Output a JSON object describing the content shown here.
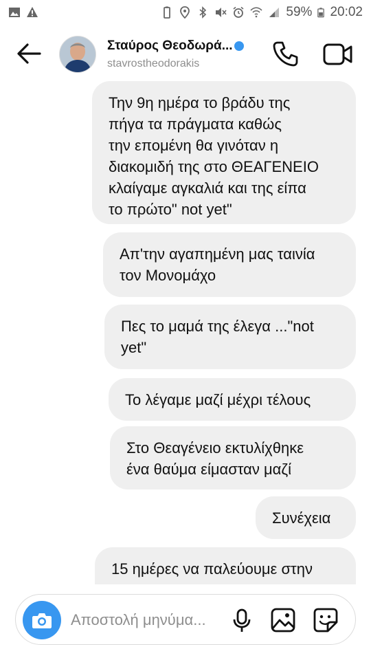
{
  "status_bar": {
    "battery": "59%",
    "time": "20:02"
  },
  "header": {
    "name": "Σταύρος Θεοδωρά...",
    "username": "stavrostheodorakis"
  },
  "messages": [
    {
      "text": "Την 9η ημέρα το βράδυ της\nπήγα τα πράγματα καθώς\nτην επομένη θα γινόταν η\nδιακομιδή της στο ΘΕΑΓΕΝΕΙΟ\nκλαίγαμε αγκαλιά και της είπα\nτο πρώτο\" not yet\""
    },
    {
      "text": "Απ'την αγαπημένη μας ταινία\nτον Μονομάχο"
    },
    {
      "text": "Πες το μαμά της έλεγα ...\"not\nyet\""
    },
    {
      "text": "Το λέγαμε μαζί μέχρι τέλους"
    },
    {
      "text": "Στο Θεαγένειο εκτυλίχθηκε\nένα θαύμα είμασταν μαζί"
    },
    {
      "text": "Συνέχεια"
    },
    {
      "text": "15 ημέρες να παλεύουμε στην"
    }
  ],
  "composer": {
    "placeholder": "Αποστολή μηνύμα..."
  },
  "colors": {
    "accent": "#3897f0",
    "bubble": "#efefef"
  }
}
